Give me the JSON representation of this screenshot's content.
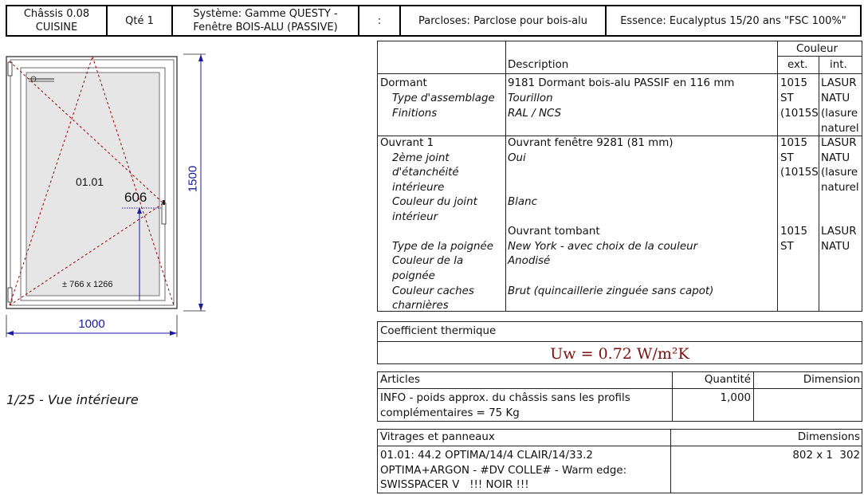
{
  "header": {
    "chassis_line1": "Châssis 0.08",
    "chassis_line2": "CUISINE",
    "qty": "Qté 1",
    "system_line1": "Système: Gamme QUESTY -",
    "system_line2": "Fenêtre BOIS-ALU (PASSIVE)",
    "colon": ":",
    "parcloses": "Parcloses: Parclose pour bois-alu",
    "essence": "Essence: Eucalyptus 15/20 ans \"FSC 100%\""
  },
  "drawing": {
    "height_dim": "1500",
    "width_dim": "1000",
    "handle_height": "606",
    "sash_label": "01.01",
    "glass_size": "± 766 x 1266",
    "scale_view": "1/25 - Vue intérieure"
  },
  "desc_table": {
    "head_couleur": "Couleur",
    "head_description": "Description",
    "head_ext": "ext.",
    "head_int": "int.",
    "dormant": {
      "label": "Dormant",
      "desc": "9181 Dormant bois-alu PASSIF en 116 mm",
      "ext": "1015",
      "int": "LASUR",
      "rows": [
        {
          "label": "Type d'assemblage",
          "value": "Tourillon",
          "ext": "ST",
          "int": "NATU"
        },
        {
          "label": "Finitions",
          "value": "RAL / NCS",
          "ext": "(1015S",
          "int": "(lasure"
        }
      ],
      "int_extra": "naturel"
    },
    "ouvrant": {
      "label": "Ouvrant 1",
      "desc": "Ouvrant fenêtre 9281 (81 mm)",
      "ext": "1015",
      "int": "LASUR",
      "ext2": "ST",
      "int2": "NATU",
      "ext3": "(1015S",
      "int3": "(lasure",
      "int4": "naturel",
      "joint_label_1": "2ème joint",
      "joint_label_2": "d'étanchéité",
      "joint_label_3": "intérieure",
      "joint_value": "Oui",
      "couleur_joint_1": "Couleur du joint",
      "couleur_joint_2": "intérieur",
      "couleur_joint_value": "Blanc",
      "tombant": "Ouvrant tombant",
      "tombant_ext": "1015",
      "tombant_int": "LASUR",
      "poignee_label": "Type de la poignée",
      "poignee_value": "New York - avec choix de la couleur",
      "poignee_ext": "ST",
      "poignee_int": "NATU",
      "coul_poignee_1": "Couleur de la",
      "coul_poignee_2": "poignée",
      "coul_poignee_value": "Anodisé",
      "caches_1": "Couleur caches",
      "caches_2": "charnières",
      "caches_value": "Brut (quincaillerie zinguée sans capot)"
    }
  },
  "thermal": {
    "title": "Coefficient thermique",
    "value": "Uw = 0.72 W/m²K"
  },
  "articles": {
    "head_articles": "Articles",
    "head_quantite": "Quantité",
    "head_dimension": "Dimension",
    "row_line1": "INFO - poids approx. du châssis sans les profils",
    "row_line2": "complémentaires = 75 Kg",
    "row_qty": "1,000"
  },
  "vitrages": {
    "head": "Vitrages et panneaux",
    "head_dim": "Dimensions",
    "line1": "01.01: 44.2 OPTIMA/14/4 CLAIR/14/33.2",
    "line2": "OPTIMA+ARGON - #DV COLLE# - Warm edge:",
    "line3": "SWISSPACER V   !!! NOIR !!!",
    "dim": "802 x 1  302"
  },
  "colors": {
    "dim_line": "#1a1aa0",
    "hinge_dash": "#a00000",
    "thermal_value": "#7a1010"
  }
}
